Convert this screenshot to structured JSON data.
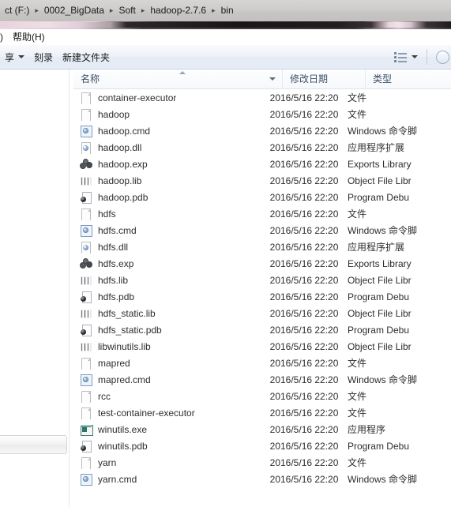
{
  "window": {
    "title_clipped": "bin"
  },
  "breadcrumb": {
    "items": [
      {
        "label": "ct (F:)"
      },
      {
        "label": "0002_BigData"
      },
      {
        "label": "Soft"
      },
      {
        "label": "hadoop-2.7.6"
      },
      {
        "label": "bin"
      }
    ],
    "separator": "▸"
  },
  "menubar": {
    "items": [
      {
        "label": ")"
      },
      {
        "label": "帮助(H)"
      }
    ]
  },
  "toolbar": {
    "share_label": "享",
    "burn_label": "刻录",
    "new_folder_label": "新建文件夹",
    "view_icon": "list-view-icon",
    "help_icon": "help-icon"
  },
  "columns": [
    {
      "key": "name",
      "label": "名称",
      "sorted": "asc"
    },
    {
      "key": "date",
      "label": "修改日期"
    },
    {
      "key": "type",
      "label": "类型"
    }
  ],
  "files": [
    {
      "name": "container-executor",
      "icon": "doc",
      "date": "2016/5/16 22:20",
      "type": "文件"
    },
    {
      "name": "hadoop",
      "icon": "doc",
      "date": "2016/5/16 22:20",
      "type": "文件"
    },
    {
      "name": "hadoop.cmd",
      "icon": "cmd",
      "date": "2016/5/16 22:20",
      "type": "Windows 命令脚"
    },
    {
      "name": "hadoop.dll",
      "icon": "dll",
      "date": "2016/5/16 22:20",
      "type": "应用程序扩展"
    },
    {
      "name": "hadoop.exp",
      "icon": "exp",
      "date": "2016/5/16 22:20",
      "type": "Exports Library"
    },
    {
      "name": "hadoop.lib",
      "icon": "lib",
      "date": "2016/5/16 22:20",
      "type": "Object File Libr"
    },
    {
      "name": "hadoop.pdb",
      "icon": "pdb",
      "date": "2016/5/16 22:20",
      "type": "Program Debu"
    },
    {
      "name": "hdfs",
      "icon": "doc",
      "date": "2016/5/16 22:20",
      "type": "文件"
    },
    {
      "name": "hdfs.cmd",
      "icon": "cmd",
      "date": "2016/5/16 22:20",
      "type": "Windows 命令脚"
    },
    {
      "name": "hdfs.dll",
      "icon": "dll",
      "date": "2016/5/16 22:20",
      "type": "应用程序扩展"
    },
    {
      "name": "hdfs.exp",
      "icon": "exp",
      "date": "2016/5/16 22:20",
      "type": "Exports Library"
    },
    {
      "name": "hdfs.lib",
      "icon": "lib",
      "date": "2016/5/16 22:20",
      "type": "Object File Libr"
    },
    {
      "name": "hdfs.pdb",
      "icon": "pdb",
      "date": "2016/5/16 22:20",
      "type": "Program Debu"
    },
    {
      "name": "hdfs_static.lib",
      "icon": "lib",
      "date": "2016/5/16 22:20",
      "type": "Object File Libr"
    },
    {
      "name": "hdfs_static.pdb",
      "icon": "pdb",
      "date": "2016/5/16 22:20",
      "type": "Program Debu"
    },
    {
      "name": "libwinutils.lib",
      "icon": "lib",
      "date": "2016/5/16 22:20",
      "type": "Object File Libr"
    },
    {
      "name": "mapred",
      "icon": "doc",
      "date": "2016/5/16 22:20",
      "type": "文件"
    },
    {
      "name": "mapred.cmd",
      "icon": "cmd",
      "date": "2016/5/16 22:20",
      "type": "Windows 命令脚"
    },
    {
      "name": "rcc",
      "icon": "doc",
      "date": "2016/5/16 22:20",
      "type": "文件"
    },
    {
      "name": "test-container-executor",
      "icon": "doc",
      "date": "2016/5/16 22:20",
      "type": "文件"
    },
    {
      "name": "winutils.exe",
      "icon": "exe",
      "date": "2016/5/16 22:20",
      "type": "应用程序"
    },
    {
      "name": "winutils.pdb",
      "icon": "pdb",
      "date": "2016/5/16 22:20",
      "type": "Program Debu"
    },
    {
      "name": "yarn",
      "icon": "doc",
      "date": "2016/5/16 22:20",
      "type": "文件"
    },
    {
      "name": "yarn.cmd",
      "icon": "cmd",
      "date": "2016/5/16 22:20",
      "type": "Windows 命令脚"
    }
  ],
  "colors": {
    "addressbar": "#cfcdcb",
    "toolbar": "#eef2f8",
    "column_header_text": "#3b5068",
    "row_text": "#2d2d2d"
  }
}
